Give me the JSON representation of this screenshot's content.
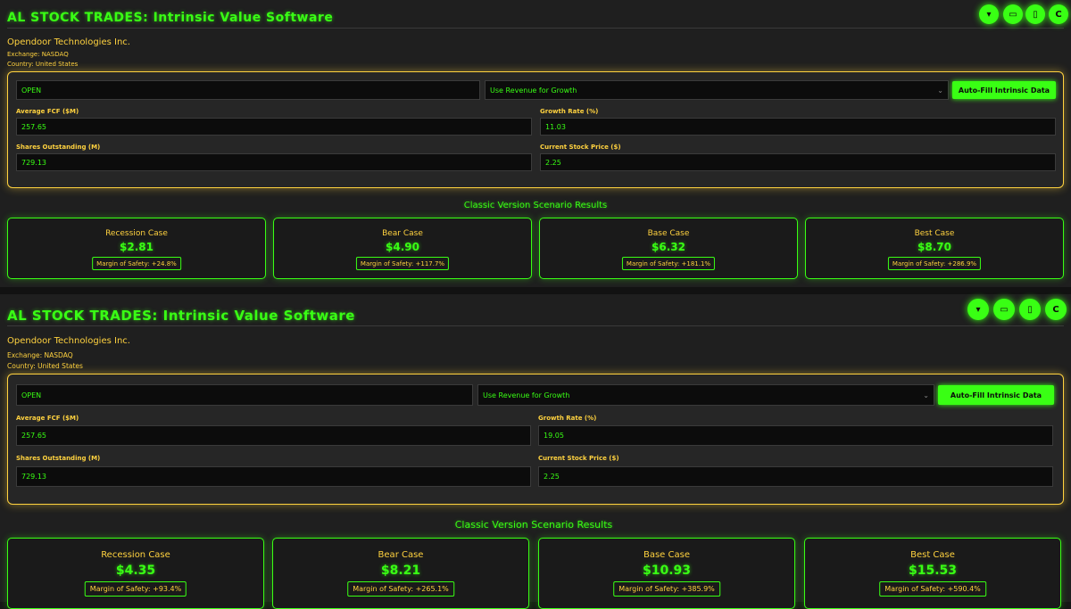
{
  "top": {
    "title": "AL STOCK TRADES: Intrinsic Value Software",
    "toolbar": [
      {
        "icon": "chevron-down-icon",
        "glyph": "▾"
      },
      {
        "icon": "camera-icon",
        "glyph": "▭"
      },
      {
        "icon": "phone-icon",
        "glyph": "▯"
      },
      {
        "icon": "refresh-icon",
        "glyph": "C"
      }
    ],
    "company": "Opendoor Technologies Inc.",
    "exchange": "Exchange: NASDAQ",
    "country": "Country: United States",
    "ticker": "OPEN",
    "growth_method": "Use Revenue for Growth",
    "autofill_label": "Auto-Fill Intrinsic Data",
    "fields": {
      "fcf_label": "Average FCF ($M)",
      "fcf_value": "257.65",
      "growth_label": "Growth Rate (%)",
      "growth_value": "11.03",
      "shares_label": "Shares Outstanding (M)",
      "shares_value": "729.13",
      "price_label": "Current Stock Price ($)",
      "price_value": "2.25"
    },
    "results_title": "Classic Version Scenario Results",
    "scenarios": [
      {
        "name": "Recession Case",
        "value": "$2.81",
        "mos": "Margin of Safety: +24.8%"
      },
      {
        "name": "Bear Case",
        "value": "$4.90",
        "mos": "Margin of Safety: +117.7%"
      },
      {
        "name": "Base Case",
        "value": "$6.32",
        "mos": "Margin of Safety: +181.1%"
      },
      {
        "name": "Best Case",
        "value": "$8.70",
        "mos": "Margin of Safety: +286.9%"
      }
    ]
  },
  "bottom": {
    "title": "AL STOCK TRADES: Intrinsic Value Software",
    "toolbar": [
      {
        "icon": "chevron-down-icon",
        "glyph": "▾"
      },
      {
        "icon": "camera-icon",
        "glyph": "▭"
      },
      {
        "icon": "phone-icon",
        "glyph": "▯"
      },
      {
        "icon": "refresh-icon",
        "glyph": "C"
      }
    ],
    "company": "Opendoor Technologies Inc.",
    "exchange": "Exchange: NASDAQ",
    "country": "Country: United States",
    "ticker": "OPEN",
    "growth_method": "Use Revenue for Growth",
    "autofill_label": "Auto-Fill Intrinsic Data",
    "fields": {
      "fcf_label": "Average FCF ($M)",
      "fcf_value": "257.65",
      "growth_label": "Growth Rate (%)",
      "growth_value": "19.05",
      "shares_label": "Shares Outstanding (M)",
      "shares_value": "729.13",
      "price_label": "Current Stock Price ($)",
      "price_value": "2.25"
    },
    "results_title": "Classic Version Scenario Results",
    "scenarios": [
      {
        "name": "Recession Case",
        "value": "$4.35",
        "mos": "Margin of Safety: +93.4%"
      },
      {
        "name": "Bear Case",
        "value": "$8.21",
        "mos": "Margin of Safety: +265.1%"
      },
      {
        "name": "Base Case",
        "value": "$10.93",
        "mos": "Margin of Safety: +385.9%"
      },
      {
        "name": "Best Case",
        "value": "$15.53",
        "mos": "Margin of Safety: +590.4%"
      }
    ]
  },
  "colors": {
    "accent_green": "#39ff14",
    "accent_yellow": "#ffd23f",
    "background": "#1f1f1f"
  }
}
